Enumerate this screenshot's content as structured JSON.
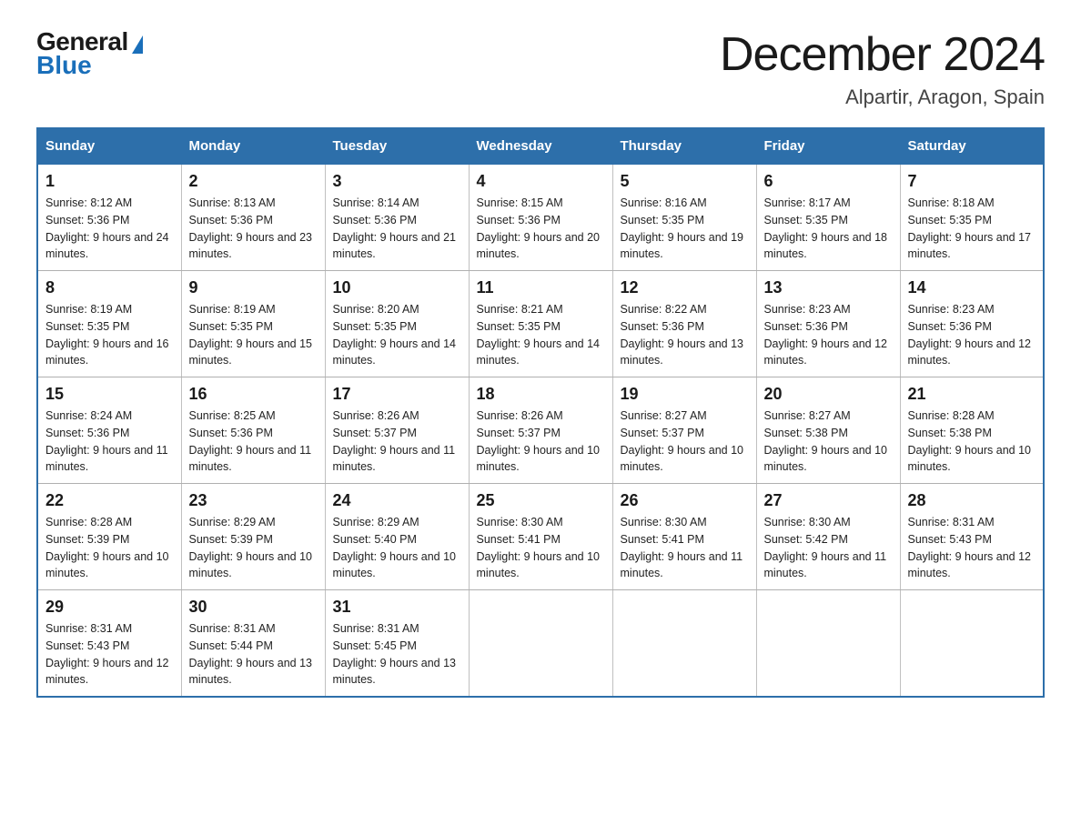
{
  "header": {
    "logo_general": "General",
    "logo_blue": "Blue",
    "title": "December 2024",
    "subtitle": "Alpartir, Aragon, Spain"
  },
  "days_of_week": [
    "Sunday",
    "Monday",
    "Tuesday",
    "Wednesday",
    "Thursday",
    "Friday",
    "Saturday"
  ],
  "weeks": [
    [
      {
        "day": "1",
        "sunrise": "8:12 AM",
        "sunset": "5:36 PM",
        "daylight": "9 hours and 24 minutes."
      },
      {
        "day": "2",
        "sunrise": "8:13 AM",
        "sunset": "5:36 PM",
        "daylight": "9 hours and 23 minutes."
      },
      {
        "day": "3",
        "sunrise": "8:14 AM",
        "sunset": "5:36 PM",
        "daylight": "9 hours and 21 minutes."
      },
      {
        "day": "4",
        "sunrise": "8:15 AM",
        "sunset": "5:36 PM",
        "daylight": "9 hours and 20 minutes."
      },
      {
        "day": "5",
        "sunrise": "8:16 AM",
        "sunset": "5:35 PM",
        "daylight": "9 hours and 19 minutes."
      },
      {
        "day": "6",
        "sunrise": "8:17 AM",
        "sunset": "5:35 PM",
        "daylight": "9 hours and 18 minutes."
      },
      {
        "day": "7",
        "sunrise": "8:18 AM",
        "sunset": "5:35 PM",
        "daylight": "9 hours and 17 minutes."
      }
    ],
    [
      {
        "day": "8",
        "sunrise": "8:19 AM",
        "sunset": "5:35 PM",
        "daylight": "9 hours and 16 minutes."
      },
      {
        "day": "9",
        "sunrise": "8:19 AM",
        "sunset": "5:35 PM",
        "daylight": "9 hours and 15 minutes."
      },
      {
        "day": "10",
        "sunrise": "8:20 AM",
        "sunset": "5:35 PM",
        "daylight": "9 hours and 14 minutes."
      },
      {
        "day": "11",
        "sunrise": "8:21 AM",
        "sunset": "5:35 PM",
        "daylight": "9 hours and 14 minutes."
      },
      {
        "day": "12",
        "sunrise": "8:22 AM",
        "sunset": "5:36 PM",
        "daylight": "9 hours and 13 minutes."
      },
      {
        "day": "13",
        "sunrise": "8:23 AM",
        "sunset": "5:36 PM",
        "daylight": "9 hours and 12 minutes."
      },
      {
        "day": "14",
        "sunrise": "8:23 AM",
        "sunset": "5:36 PM",
        "daylight": "9 hours and 12 minutes."
      }
    ],
    [
      {
        "day": "15",
        "sunrise": "8:24 AM",
        "sunset": "5:36 PM",
        "daylight": "9 hours and 11 minutes."
      },
      {
        "day": "16",
        "sunrise": "8:25 AM",
        "sunset": "5:36 PM",
        "daylight": "9 hours and 11 minutes."
      },
      {
        "day": "17",
        "sunrise": "8:26 AM",
        "sunset": "5:37 PM",
        "daylight": "9 hours and 11 minutes."
      },
      {
        "day": "18",
        "sunrise": "8:26 AM",
        "sunset": "5:37 PM",
        "daylight": "9 hours and 10 minutes."
      },
      {
        "day": "19",
        "sunrise": "8:27 AM",
        "sunset": "5:37 PM",
        "daylight": "9 hours and 10 minutes."
      },
      {
        "day": "20",
        "sunrise": "8:27 AM",
        "sunset": "5:38 PM",
        "daylight": "9 hours and 10 minutes."
      },
      {
        "day": "21",
        "sunrise": "8:28 AM",
        "sunset": "5:38 PM",
        "daylight": "9 hours and 10 minutes."
      }
    ],
    [
      {
        "day": "22",
        "sunrise": "8:28 AM",
        "sunset": "5:39 PM",
        "daylight": "9 hours and 10 minutes."
      },
      {
        "day": "23",
        "sunrise": "8:29 AM",
        "sunset": "5:39 PM",
        "daylight": "9 hours and 10 minutes."
      },
      {
        "day": "24",
        "sunrise": "8:29 AM",
        "sunset": "5:40 PM",
        "daylight": "9 hours and 10 minutes."
      },
      {
        "day": "25",
        "sunrise": "8:30 AM",
        "sunset": "5:41 PM",
        "daylight": "9 hours and 10 minutes."
      },
      {
        "day": "26",
        "sunrise": "8:30 AM",
        "sunset": "5:41 PM",
        "daylight": "9 hours and 11 minutes."
      },
      {
        "day": "27",
        "sunrise": "8:30 AM",
        "sunset": "5:42 PM",
        "daylight": "9 hours and 11 minutes."
      },
      {
        "day": "28",
        "sunrise": "8:31 AM",
        "sunset": "5:43 PM",
        "daylight": "9 hours and 12 minutes."
      }
    ],
    [
      {
        "day": "29",
        "sunrise": "8:31 AM",
        "sunset": "5:43 PM",
        "daylight": "9 hours and 12 minutes."
      },
      {
        "day": "30",
        "sunrise": "8:31 AM",
        "sunset": "5:44 PM",
        "daylight": "9 hours and 13 minutes."
      },
      {
        "day": "31",
        "sunrise": "8:31 AM",
        "sunset": "5:45 PM",
        "daylight": "9 hours and 13 minutes."
      },
      null,
      null,
      null,
      null
    ]
  ]
}
